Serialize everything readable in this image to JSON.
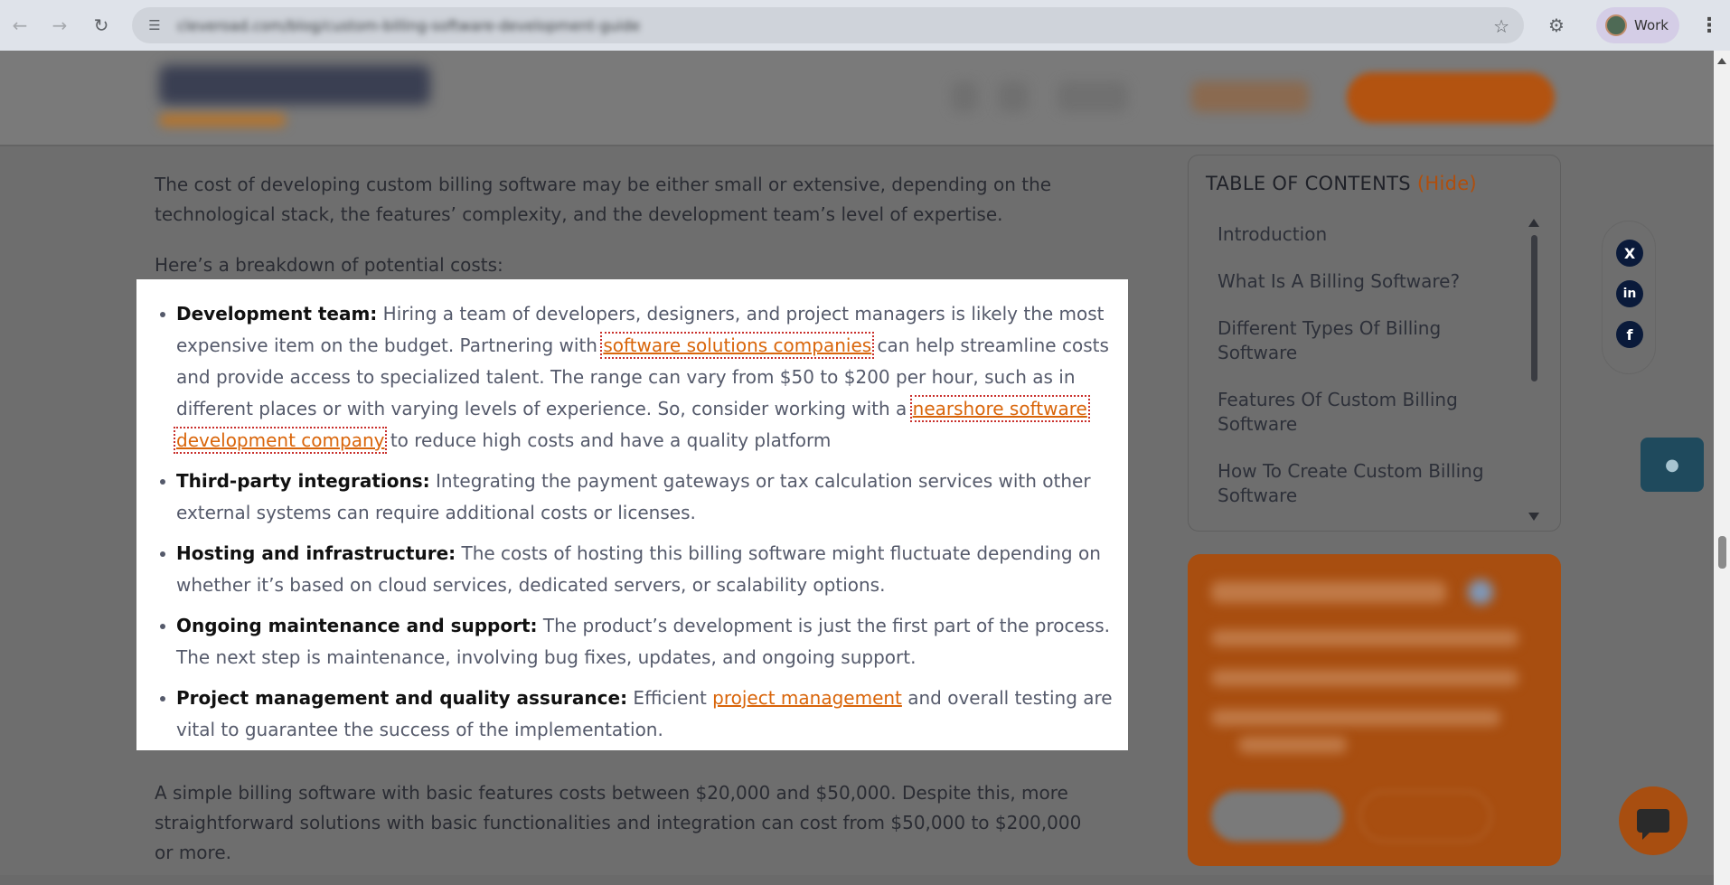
{
  "browser": {
    "url": "cleveroad.com/blog/custom-billing-software-development-guide",
    "profile_label": "Work",
    "icons": {
      "back": "back-arrow-icon",
      "forward": "forward-arrow-icon",
      "reload": "reload-icon",
      "site_info": "tune-icon",
      "bookmark": "star-icon",
      "extensions": "puzzle-icon",
      "menu": "more-vert-icon"
    }
  },
  "article": {
    "intro_paragraph": "The cost of developing custom billing software may be either small or extensive, depending on the technological stack, the features’ complexity, and the development team’s level of expertise.",
    "breakdown_intro": "Here’s a breakdown of potential costs:",
    "bullets": [
      {
        "title": "Development team:",
        "text_1": " Hiring a team of developers, designers, and project managers is likely the most expensive item on the budget. Partnering with ",
        "link_1": "software solutions companies",
        "text_2": " can help streamline costs and provide access to specialized talent. The range can vary from $50 to $200 per hour, such as in different places or with varying levels of experience. So, consider working with a ",
        "link_2": "nearshore software development company",
        "text_3": " to reduce high costs and have a quality platform"
      },
      {
        "title": "Third-party integrations:",
        "text": " Integrating the payment gateways or tax calculation services with other external systems can require additional costs or licenses."
      },
      {
        "title": "Hosting and infrastructure:",
        "text": " The costs of hosting this billing software might fluctuate depending on whether it’s based on cloud services, dedicated servers, or scalability options."
      },
      {
        "title": "Ongoing maintenance and support:",
        "text": " The product’s development is just the first part of the process. The next step is maintenance, involving bug fixes, updates, and ongoing support."
      },
      {
        "title": "Project management and quality assurance:",
        "text_1": " Efficient ",
        "link_1": "project management",
        "text_2": " and overall testing are vital to guarantee the success of the implementation."
      }
    ],
    "closing_paragraph": "A simple billing software with basic features costs between $20,000 and $50,000. Despite this, more straightforward solutions with basic functionalities and integration can cost from $50,000 to $200,000 or more."
  },
  "toc": {
    "title": "TABLE OF CONTENTS",
    "hide_label": "(Hide)",
    "items": [
      "Introduction",
      "What Is A Billing Software?",
      "Different Types Of Billing Software",
      "Features Of Custom Billing Software",
      "How To Create Custom Billing Software"
    ]
  },
  "social": {
    "x": "X",
    "linkedin": "in",
    "facebook": "f"
  },
  "colors": {
    "accent_orange": "#d9650a",
    "link_outline": "#c9302c",
    "dim_overlay": "#6e6e6e",
    "panel": "#ffffff"
  }
}
